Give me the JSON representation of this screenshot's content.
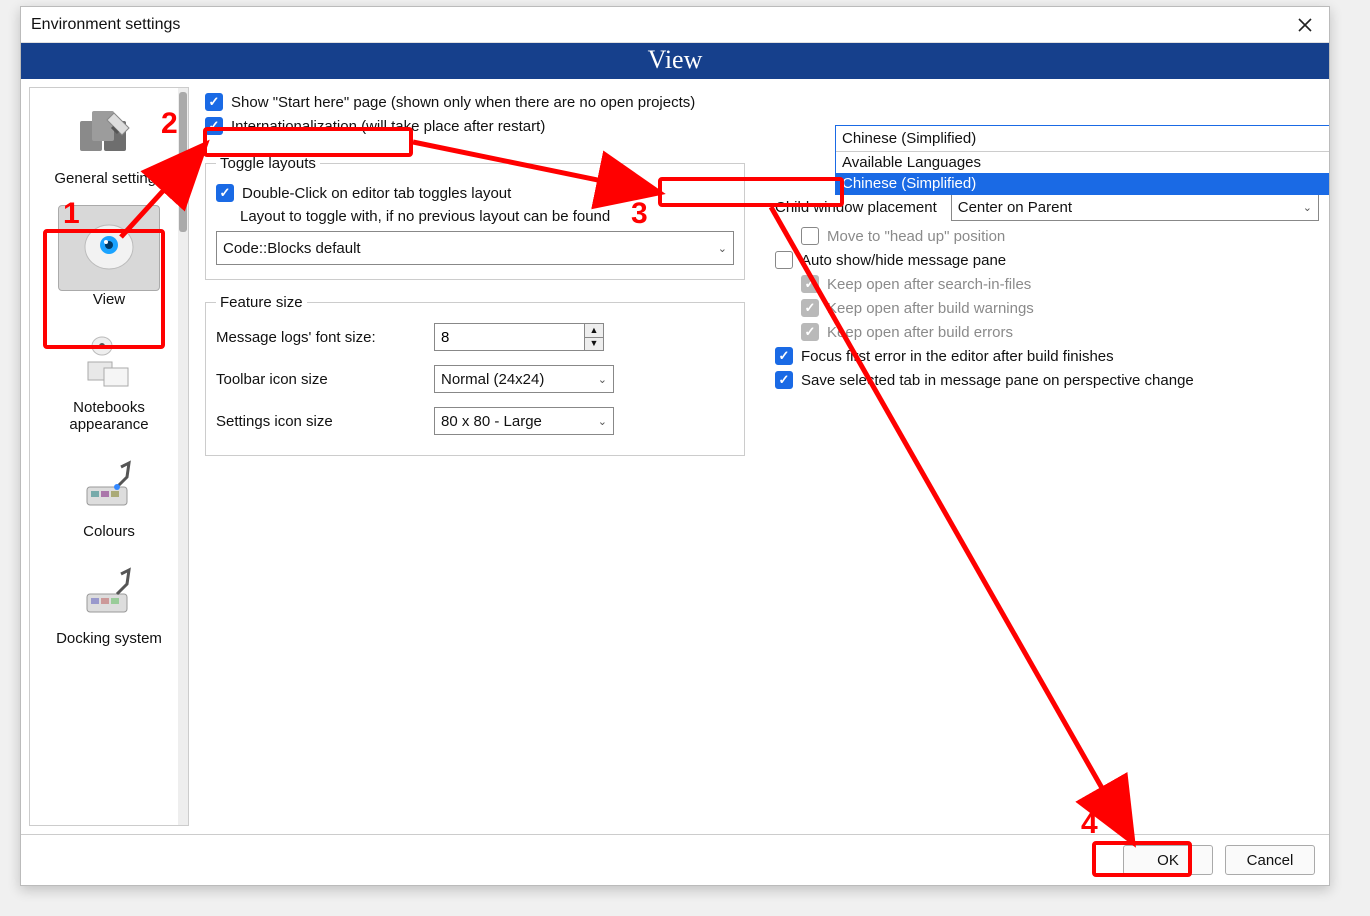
{
  "dialog": {
    "title": "Environment settings"
  },
  "header": {
    "title": "View"
  },
  "sidebar": {
    "items": [
      {
        "label": "General settings"
      },
      {
        "label": "View"
      },
      {
        "label": "Notebooks appearance"
      },
      {
        "label": "Colours"
      },
      {
        "label": "Docking system"
      }
    ]
  },
  "opts": {
    "start_here": "Show \"Start here\" page (shown only when there are no open projects)",
    "i18n": "Internationalization (will take place after restart)"
  },
  "lang": {
    "selected": "Chinese (Simplified)",
    "header": "Available Languages",
    "option": "Chinese (Simplified)"
  },
  "toggle": {
    "legend": "Toggle layouts",
    "dbl": "Double-Click on editor tab toggles layout",
    "fallback": "Layout to toggle with, if no previous layout can be found",
    "fallback_value": "Code::Blocks default"
  },
  "feat": {
    "legend": "Feature size",
    "msg_font_label": "Message logs' font size:",
    "msg_font_value": "8",
    "toolbar_label": "Toolbar icon size",
    "toolbar_value": "Normal (24x24)",
    "settings_label": "Settings icon size",
    "settings_value": "80 x 80 - Large"
  },
  "right": {
    "child_label": "Child window placement",
    "child_value": "Center on Parent",
    "headup": "Move to \"head up\" position",
    "autoshow": "Auto show/hide message pane",
    "keep_search": "Keep open after search-in-files",
    "keep_warn": "Keep open after build warnings",
    "keep_err": "Keep open after build errors",
    "focus_err": "Focus first error in the editor after build finishes",
    "save_tab": "Save selected tab in message pane on perspective change"
  },
  "buttons": {
    "ok": "OK",
    "cancel": "Cancel"
  },
  "anno": {
    "n1": "1",
    "n2": "2",
    "n3": "3",
    "n4": "4"
  }
}
